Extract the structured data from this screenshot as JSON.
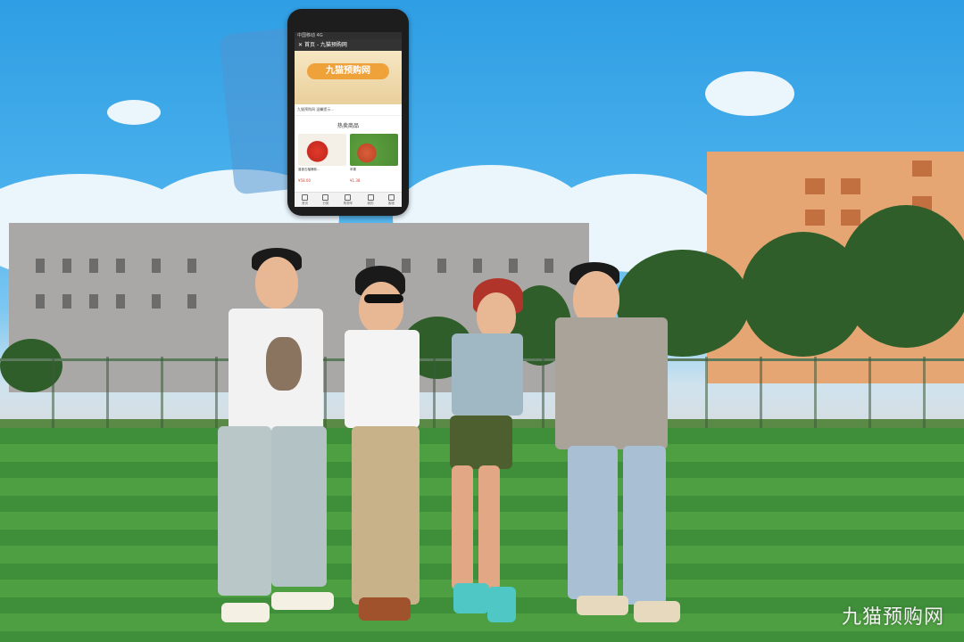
{
  "phone": {
    "status_bar": "中国移动 4G",
    "app_title": "首页 - 九猫预购网",
    "banner_title": "九猫预购网",
    "notice_text": "九猫预购网 温馨提示...",
    "section_title": "热卖商品",
    "products": [
      {
        "name": "曾被石榴爆款...",
        "price": "¥58.00"
      },
      {
        "name": "苹果",
        "price": "¥1.38"
      }
    ],
    "tabs": [
      "首页",
      "分类",
      "购物车",
      "我的",
      "客服"
    ]
  },
  "watermark": "九猫预购网",
  "colors": {
    "sky": "#2f9ee4",
    "turf": "#3f8f3a",
    "brand_orange": "#f0a23a"
  }
}
